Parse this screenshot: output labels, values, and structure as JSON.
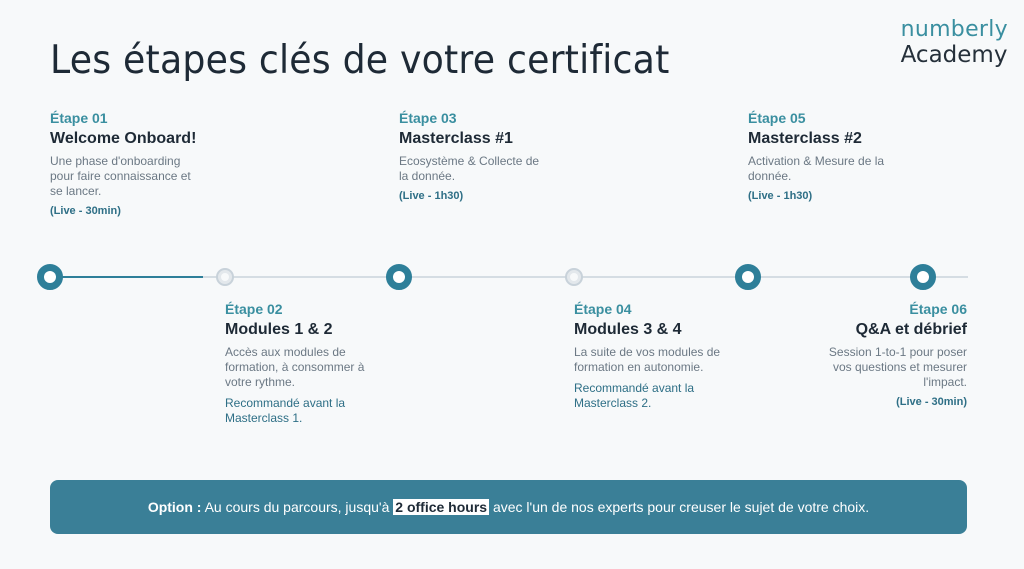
{
  "title": "Les étapes clés de votre certificat",
  "logo": {
    "top": "numberly",
    "bottom": "Academy"
  },
  "steps": [
    {
      "num": "Étape 01",
      "title": "Welcome Onboard!",
      "desc": "Une phase d'onboarding pour faire connaissance et se lancer.",
      "note": "(Live - 30min)"
    },
    {
      "num": "Étape 02",
      "title": "Modules 1 & 2",
      "desc": "Accès aux modules de formation, à consommer à votre rythme.",
      "reco": "Recommandé avant la Masterclass 1."
    },
    {
      "num": "Étape 03",
      "title": "Masterclass #1",
      "desc": "Ecosystème & Collecte de la donnée.",
      "note": "(Live - 1h30)"
    },
    {
      "num": "Étape 04",
      "title": "Modules 3 & 4",
      "desc": "La suite de vos modules de formation en autonomie.",
      "reco": "Recommandé avant la Masterclass 2."
    },
    {
      "num": "Étape 05",
      "title": "Masterclass #2",
      "desc": "Activation & Mesure de la donnée.",
      "note": "(Live - 1h30)"
    },
    {
      "num": "Étape 06",
      "title": "Q&A et débrief",
      "desc": "Session 1-to-1 pour poser vos questions et mesurer l'impact.",
      "note": "(Live - 30min)"
    }
  ],
  "banner": {
    "label": "Option :",
    "text_before": " Au cours du parcours, jusqu'à ",
    "highlight": "2 office hours",
    "text_after": " avec l'un de nos experts pour creuser le sujet de votre choix."
  },
  "colors": {
    "accent": "#2e7f99",
    "banner": "#3a7f97",
    "text": "#1e2a36"
  }
}
